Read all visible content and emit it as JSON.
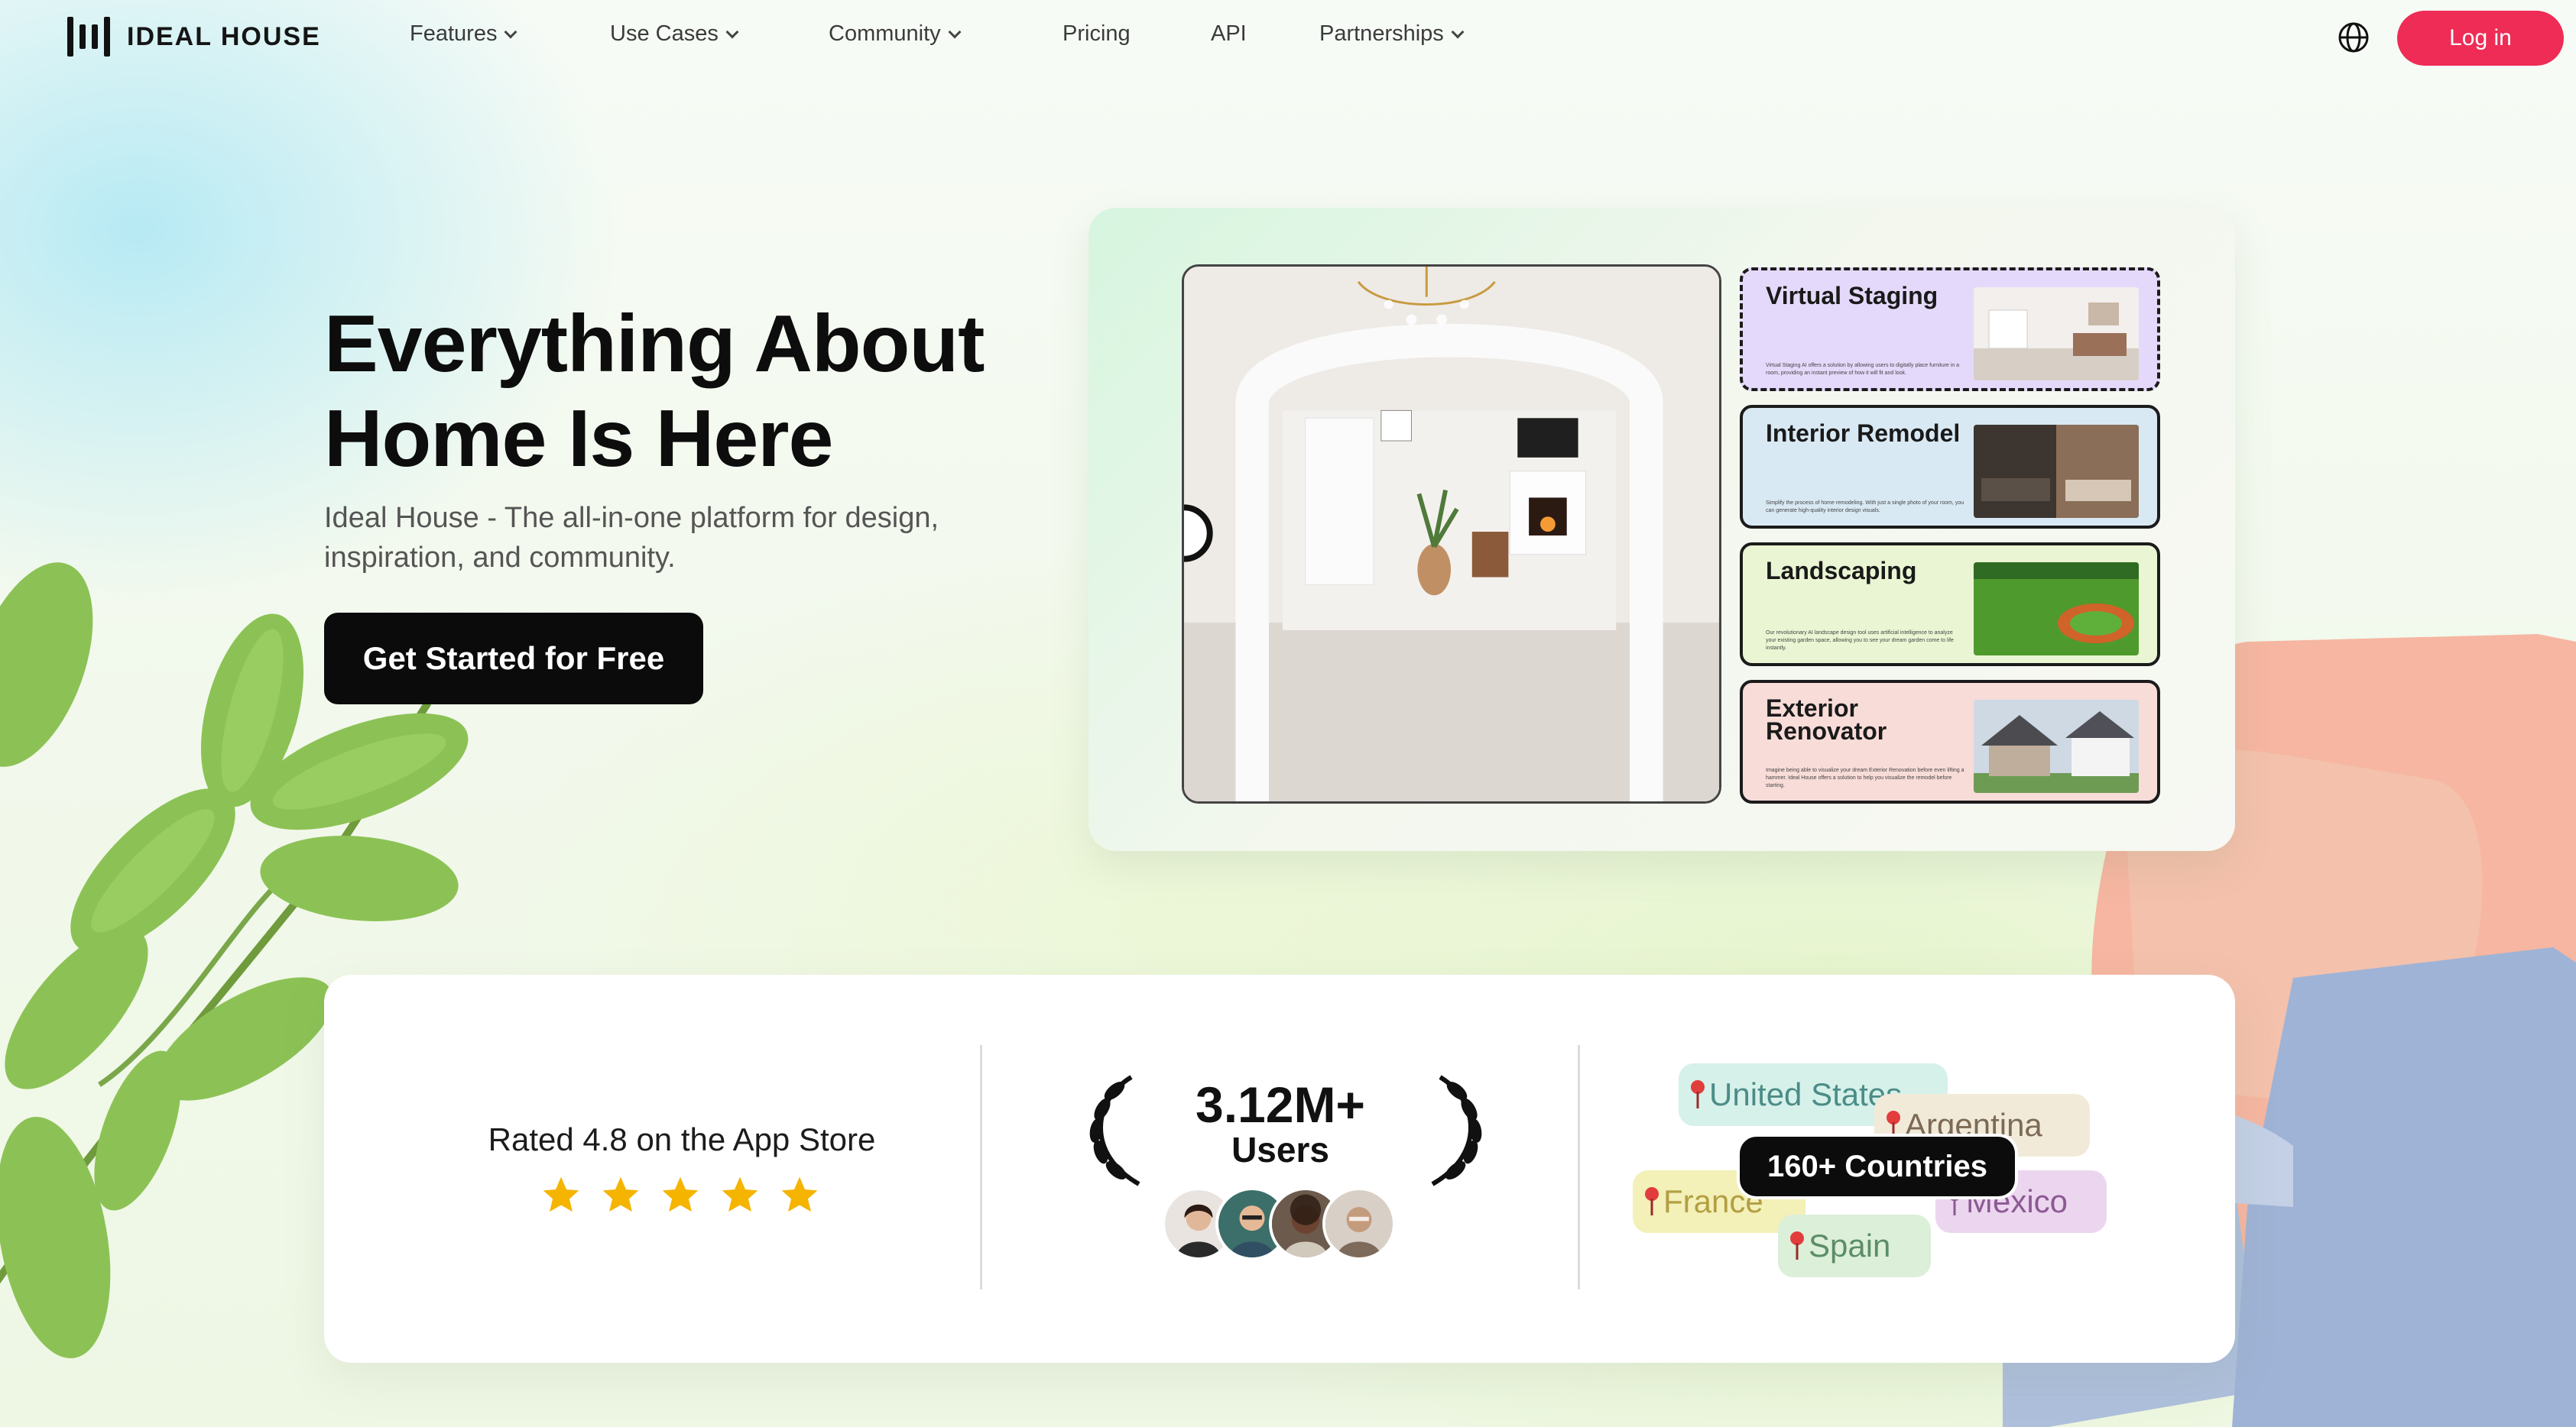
{
  "brand": {
    "name": "IDEAL HOUSE"
  },
  "nav": {
    "items": [
      {
        "label": "Features",
        "has_dropdown": true
      },
      {
        "label": "Use Cases",
        "has_dropdown": true
      },
      {
        "label": "Community",
        "has_dropdown": true
      },
      {
        "label": "Pricing",
        "has_dropdown": false
      },
      {
        "label": "API",
        "has_dropdown": false
      },
      {
        "label": "Partnerships",
        "has_dropdown": true
      }
    ],
    "language_icon": "globe-icon",
    "login_label": "Log in"
  },
  "hero": {
    "title_line1": "Everything About",
    "title_line2": "Home Is Here",
    "subtitle": "Ideal House - The all-in-one platform for design, inspiration, and community.",
    "cta_label": "Get Started for Free"
  },
  "showcase": {
    "cards": [
      {
        "title": "Virtual Staging",
        "desc": "Virtual Staging AI offers a solution by allowing users to digitally place furniture in a room, providing an instant preview of how it will fit and look.",
        "color": "#e5d9fb"
      },
      {
        "title": "Interior Remodel",
        "desc": "Simplify the process of home remodeling. With just a single photo of your room, you can generate high-quality interior design visuals.",
        "color": "#d9e9f4"
      },
      {
        "title": "Landscaping",
        "desc": "Our revolutionary AI landscape design tool uses artificial intelligence to analyze your existing garden space, allowing you to see your dream garden come to life instantly.",
        "color": "#eaf6d3"
      },
      {
        "title": "Exterior Renovator",
        "desc": "Imagine being able to visualize your dream Exterior Renovation before even lifting a hammer. Ideal House offers a solution to help you visualize the remodel before starting.",
        "color": "#f8dcd8"
      }
    ]
  },
  "stats": {
    "rating_text": "Rated 4.8 on the App Store",
    "rating_value": 4.8,
    "stars_shown": 5,
    "users_value": "3.12M+",
    "users_label": "Users",
    "countries_label": "160+ Countries",
    "country_tags": [
      "United States",
      "Argentina",
      "France",
      "Mexico",
      "Spain"
    ]
  },
  "colors": {
    "accent": "#ee2c55",
    "cta": "#0b0b0b",
    "star": "#f5b400"
  }
}
